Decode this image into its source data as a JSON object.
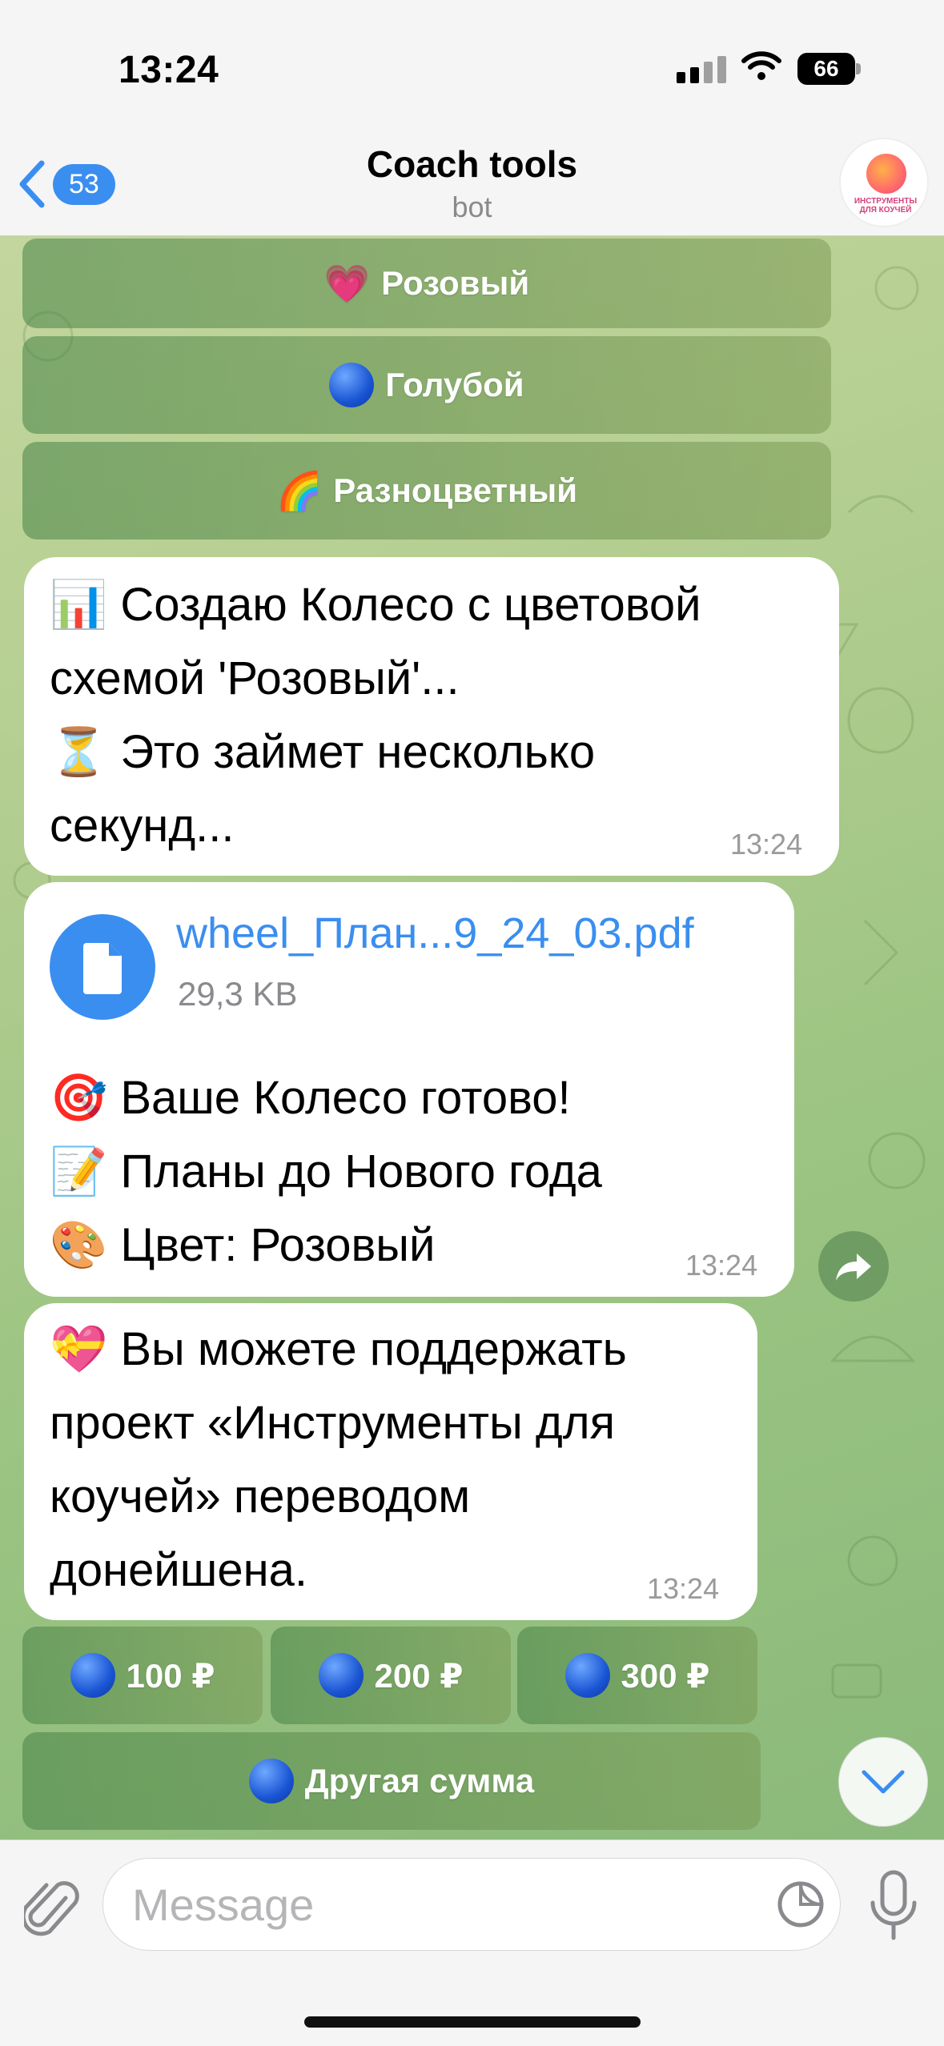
{
  "status_bar": {
    "time": "13:24",
    "battery": "66"
  },
  "nav": {
    "back_count": "53",
    "title": "Coach tools",
    "subtitle": "bot",
    "avatar_text": "ИНСТРУМЕНТЫ ДЛЯ КОУЧЕЙ"
  },
  "color_buttons": [
    {
      "emoji": "💗",
      "label": "Розовый"
    },
    {
      "emoji": "🔵",
      "label": "Голубой"
    },
    {
      "emoji": "🌈",
      "label": "Разноцветный"
    }
  ],
  "messages": {
    "creating": {
      "text": "📊 Создаю Колесо с цветовой\nсхемой 'Розовый'...\n⏳ Это займет несколько\nсекунд...",
      "time": "13:24"
    },
    "file": {
      "name": "wheel_План...9_24_03.pdf",
      "size": "29,3 KB",
      "text": "🎯 Ваше Колесо готово!\n📝 Планы до Нового года\n🎨 Цвет: Розовый",
      "time": "13:24"
    },
    "support": {
      "text": "💝 Вы можете поддержать\nпроект «Инструменты для\nкоучей» переводом\nдонейшена.",
      "time": "13:24"
    }
  },
  "donation_buttons": [
    {
      "label": "100 ₽"
    },
    {
      "label": "200 ₽"
    },
    {
      "label": "300 ₽"
    },
    {
      "label": "Другая сумма"
    }
  ],
  "input": {
    "placeholder": "Message"
  },
  "colors": {
    "accent": "#3a8ef0",
    "bubble": "#ffffff"
  }
}
